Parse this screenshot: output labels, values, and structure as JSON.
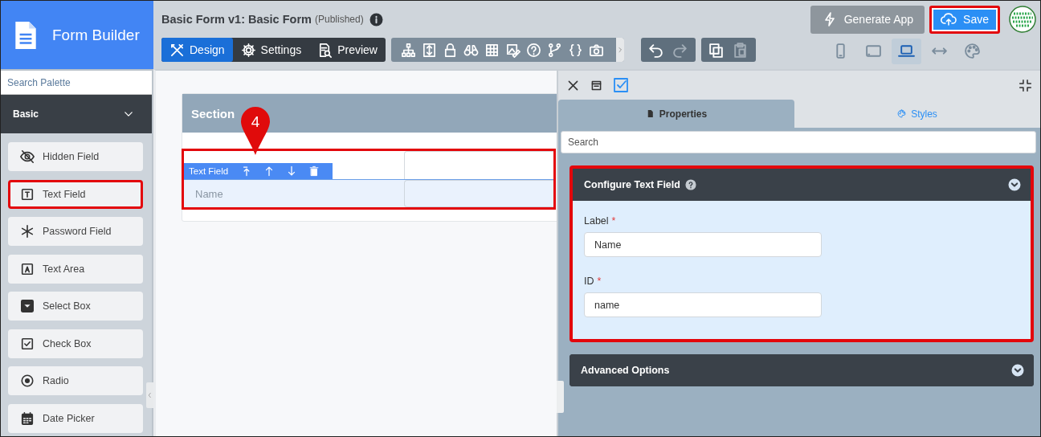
{
  "app": {
    "title": "Form Builder"
  },
  "form": {
    "title": "Basic Form v1: Basic Form",
    "status": "(Published)"
  },
  "mode_tabs": [
    {
      "label": "Design",
      "selected": true
    },
    {
      "label": "Settings",
      "selected": false
    },
    {
      "label": "Preview",
      "selected": false
    }
  ],
  "history": [
    {
      "kind": "undo",
      "disabled": false
    },
    {
      "kind": "redo",
      "disabled": true
    }
  ],
  "clipboard": [
    {
      "kind": "copy",
      "disabled": false
    },
    {
      "kind": "paste",
      "disabled": true
    }
  ],
  "header_buttons": [
    {
      "label": "Generate App",
      "kind": "secondary",
      "highlighted": false
    },
    {
      "label": "Save",
      "kind": "primary",
      "highlighted": true
    }
  ],
  "device_views": [
    {
      "kind": "phone",
      "selected": false
    },
    {
      "kind": "tablet",
      "selected": false
    },
    {
      "kind": "laptop",
      "selected": true
    },
    {
      "kind": "fit-width",
      "selected": false
    },
    {
      "kind": "palette",
      "selected": false
    }
  ],
  "palette": {
    "placeholder": "Search Palette",
    "group": {
      "label": "Basic",
      "expanded": true
    },
    "items": [
      {
        "label": "Hidden Field",
        "highlighted": false
      },
      {
        "label": "Text Field",
        "highlighted": true
      },
      {
        "label": "Password Field",
        "highlighted": false
      },
      {
        "label": "Text Area",
        "highlighted": false
      },
      {
        "label": "Select Box",
        "highlighted": false
      },
      {
        "label": "Check Box",
        "highlighted": false
      },
      {
        "label": "Radio",
        "highlighted": false
      },
      {
        "label": "Date Picker",
        "highlighted": false
      }
    ]
  },
  "canvas": {
    "section": {
      "title": "Section"
    },
    "component": {
      "type_label": "Text Field",
      "label": "Name",
      "highlighted": true
    },
    "step_marker": "4"
  },
  "properties": {
    "tabs": [
      {
        "label": "Properties",
        "selected": true
      },
      {
        "label": "Styles",
        "selected": false
      }
    ],
    "search_placeholder": "Search",
    "panels": [
      {
        "title": "Configure Text Field",
        "expanded": true,
        "highlighted": true,
        "fields": [
          {
            "label": "Label",
            "required_mark": "*",
            "value": "Name"
          },
          {
            "label": "ID",
            "required_mark": "*",
            "value": "name"
          }
        ]
      },
      {
        "title": "Advanced Options",
        "expanded": false,
        "highlighted": false
      }
    ]
  }
}
